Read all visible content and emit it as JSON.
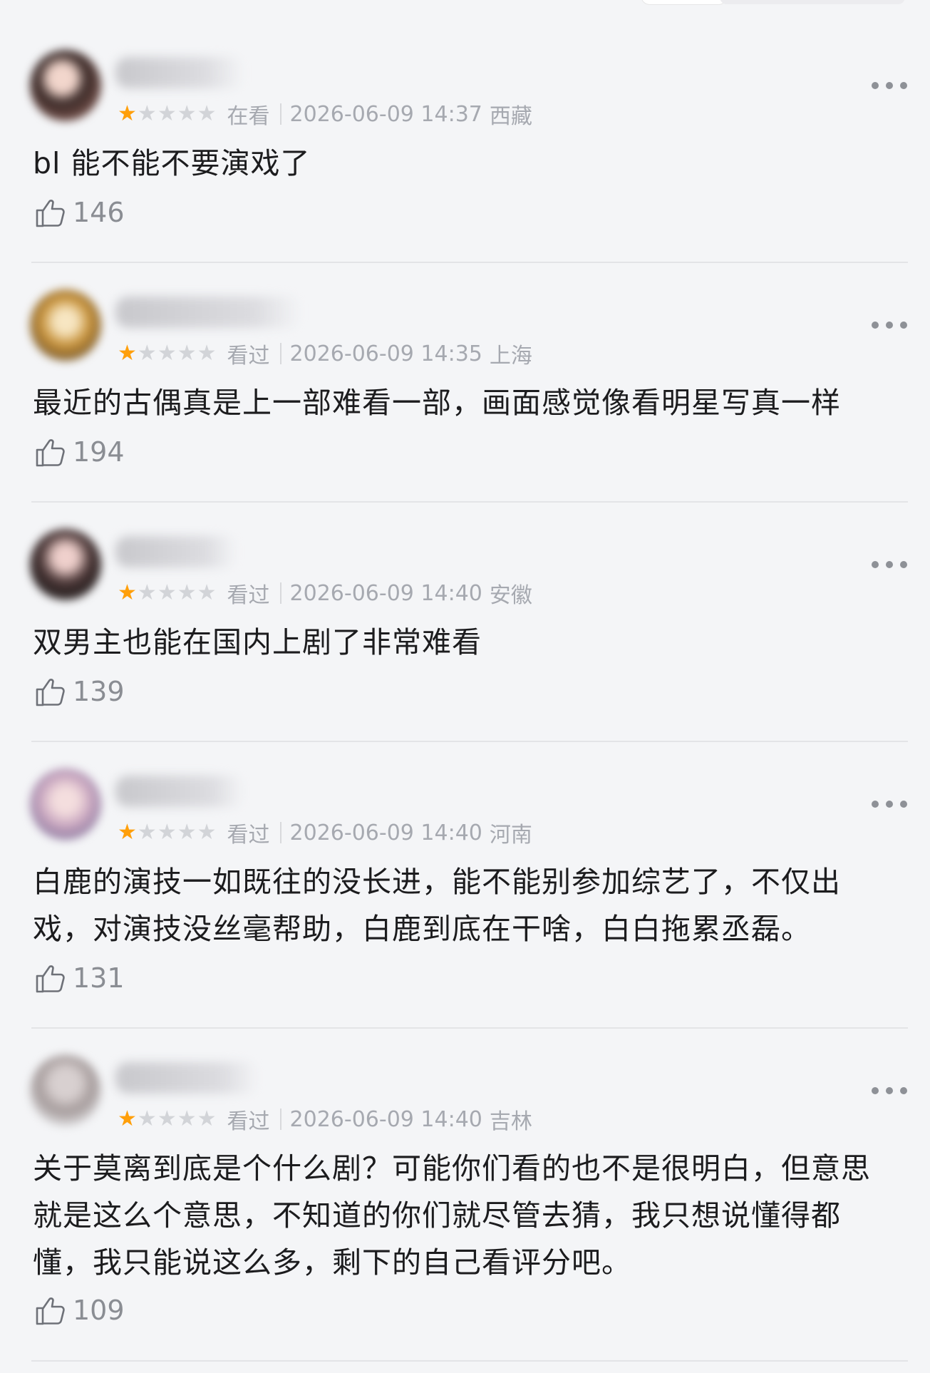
{
  "comments": [
    {
      "username": "马蒙蒙",
      "status": "在看",
      "date": "2026-06-09 14:37",
      "location": "西藏",
      "rating": 1,
      "text": "bl 能不能不要演戏了",
      "likes": "146"
    },
    {
      "username": "小美的小鹿丫",
      "status": "看过",
      "date": "2026-06-09 14:35",
      "location": "上海",
      "rating": 1,
      "text": "最近的古偶真是上一部难看一部，画面感觉像看明星写真一样",
      "likes": "194"
    },
    {
      "username": "Eternity",
      "status": "看过",
      "date": "2026-06-09 14:40",
      "location": "安徽",
      "rating": 1,
      "text": "双男主也能在国内上剧了非常难看",
      "likes": "139"
    },
    {
      "username": "好看不够",
      "status": "看过",
      "date": "2026-06-09 14:40",
      "location": "河南",
      "rating": 1,
      "text": "白鹿的演技一如既往的没长进，能不能别参加综艺了，不仅出戏，对演技没丝毫帮助，白鹿到底在干啥，白白拖累丞磊。",
      "likes": "131"
    },
    {
      "username": "节 Yuan A",
      "status": "看过",
      "date": "2026-06-09 14:40",
      "location": "吉林",
      "rating": 1,
      "text": "关于莫离到底是个什么剧？可能你们看的也不是很明白，但意思就是这么个意思，不知道的你们就尽管去猜，我只想说懂得都懂，我只能说这么多，剩下的自己看评分吧。",
      "likes": "109"
    }
  ],
  "colors": {
    "star_active": "#ff9f0a",
    "star_inactive": "#d2d4d8",
    "meta_text": "#a6a9b0",
    "background": "#f4f5f7"
  },
  "icons": {
    "like": "thumbs-up-icon",
    "more": "more-dots-icon",
    "star": "star-icon"
  }
}
